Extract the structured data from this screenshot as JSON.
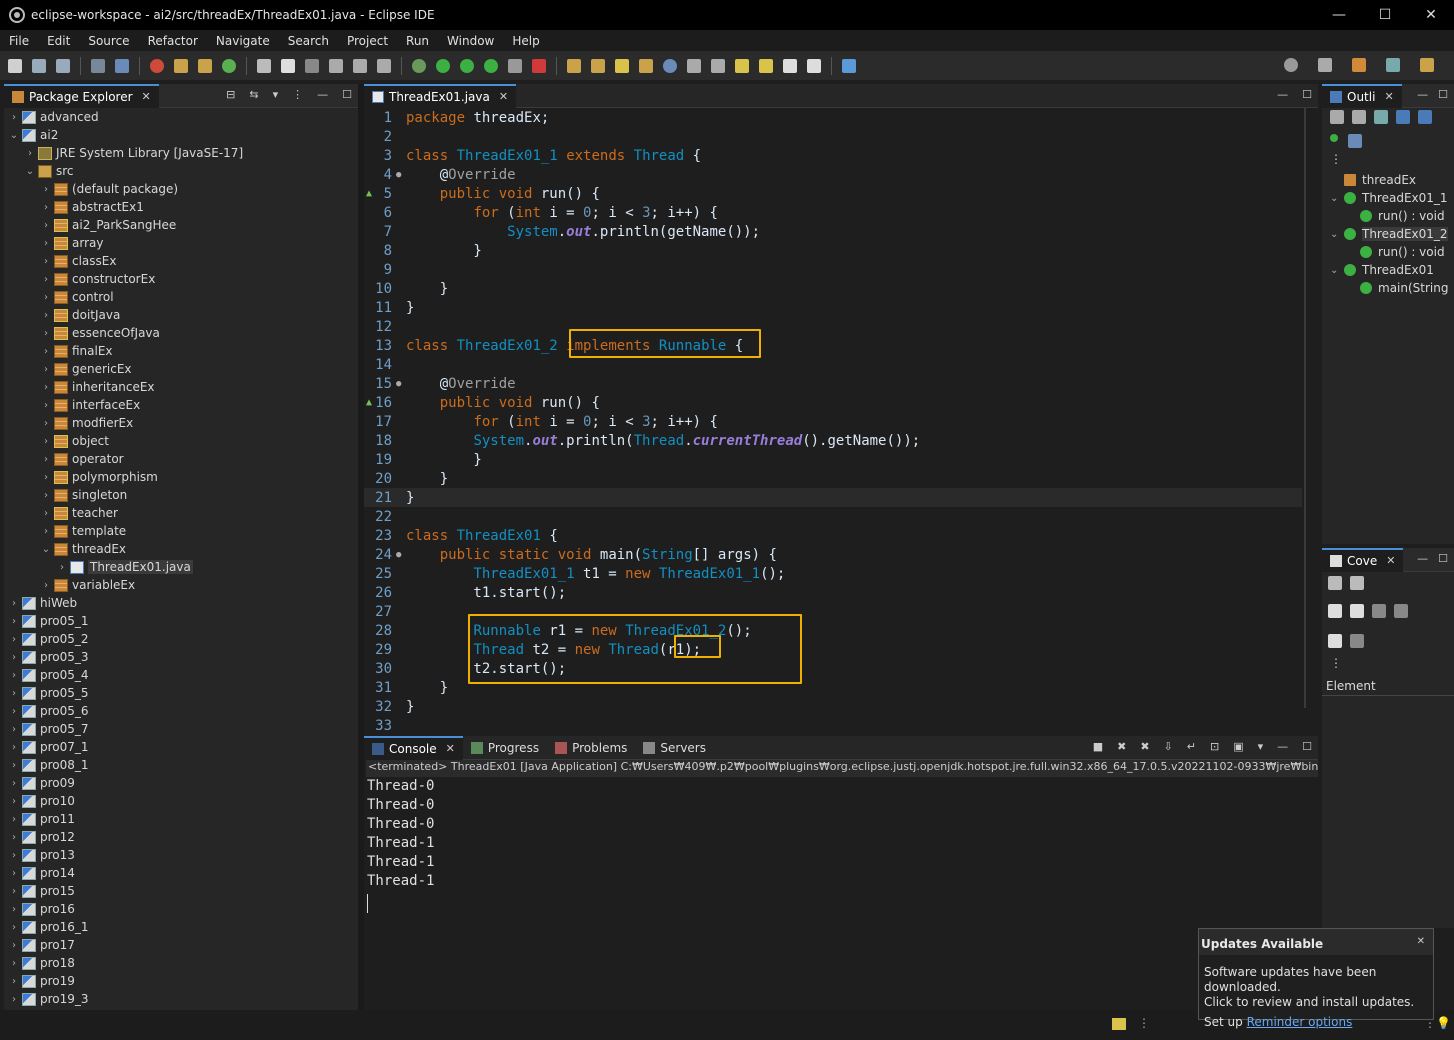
{
  "window": {
    "title": "eclipse-workspace - ai2/src/threadEx/ThreadEx01.java - Eclipse IDE",
    "minimize": "—",
    "maximize": "☐",
    "close": "✕"
  },
  "menu": [
    "File",
    "Edit",
    "Source",
    "Refactor",
    "Navigate",
    "Search",
    "Project",
    "Run",
    "Window",
    "Help"
  ],
  "package_explorer": {
    "tab_label": "Package Explorer",
    "items": [
      {
        "label": "advanced",
        "arrow": "›",
        "icon": "proj",
        "depth": 0
      },
      {
        "label": "ai2",
        "arrow": "⌄",
        "icon": "proj",
        "depth": 0
      },
      {
        "label": "JRE System Library [JavaSE-17]",
        "arrow": "›",
        "icon": "lib",
        "depth": 1
      },
      {
        "label": "src",
        "arrow": "⌄",
        "icon": "src",
        "depth": 1
      },
      {
        "label": "(default package)",
        "arrow": "›",
        "icon": "pkg",
        "depth": 2
      },
      {
        "label": "abstractEx1",
        "arrow": "›",
        "icon": "pkg",
        "depth": 2
      },
      {
        "label": "ai2_ParkSangHee",
        "arrow": "›",
        "icon": "pkgx",
        "depth": 2
      },
      {
        "label": "array",
        "arrow": "›",
        "icon": "pkgx",
        "depth": 2
      },
      {
        "label": "classEx",
        "arrow": "›",
        "icon": "pkg",
        "depth": 2
      },
      {
        "label": "constructorEx",
        "arrow": "›",
        "icon": "pkg",
        "depth": 2
      },
      {
        "label": "control",
        "arrow": "›",
        "icon": "pkg",
        "depth": 2
      },
      {
        "label": "doitJava",
        "arrow": "›",
        "icon": "pkgx",
        "depth": 2
      },
      {
        "label": "essenceOfJava",
        "arrow": "›",
        "icon": "pkgx",
        "depth": 2
      },
      {
        "label": "finalEx",
        "arrow": "›",
        "icon": "pkg",
        "depth": 2
      },
      {
        "label": "genericEx",
        "arrow": "›",
        "icon": "pkg",
        "depth": 2
      },
      {
        "label": "inheritanceEx",
        "arrow": "›",
        "icon": "pkg",
        "depth": 2
      },
      {
        "label": "interfaceEx",
        "arrow": "›",
        "icon": "pkg",
        "depth": 2
      },
      {
        "label": "modfierEx",
        "arrow": "›",
        "icon": "pkg",
        "depth": 2
      },
      {
        "label": "object",
        "arrow": "›",
        "icon": "pkgx",
        "depth": 2
      },
      {
        "label": "operator",
        "arrow": "›",
        "icon": "pkg",
        "depth": 2
      },
      {
        "label": "polymorphism",
        "arrow": "›",
        "icon": "pkgx",
        "depth": 2
      },
      {
        "label": "singleton",
        "arrow": "›",
        "icon": "pkg",
        "depth": 2
      },
      {
        "label": "teacher",
        "arrow": "›",
        "icon": "pkgx",
        "depth": 2
      },
      {
        "label": "template",
        "arrow": "›",
        "icon": "pkg",
        "depth": 2
      },
      {
        "label": "threadEx",
        "arrow": "⌄",
        "icon": "pkg",
        "depth": 2
      },
      {
        "label": "ThreadEx01.java",
        "arrow": "›",
        "icon": "java",
        "depth": 3,
        "selected": true
      },
      {
        "label": "variableEx",
        "arrow": "›",
        "icon": "pkg",
        "depth": 2
      },
      {
        "label": "hiWeb",
        "arrow": "›",
        "icon": "proj",
        "depth": 0
      },
      {
        "label": "pro05_1",
        "arrow": "›",
        "icon": "proj",
        "depth": 0
      },
      {
        "label": "pro05_2",
        "arrow": "›",
        "icon": "proj",
        "depth": 0
      },
      {
        "label": "pro05_3",
        "arrow": "›",
        "icon": "proj",
        "depth": 0
      },
      {
        "label": "pro05_4",
        "arrow": "›",
        "icon": "proj",
        "depth": 0
      },
      {
        "label": "pro05_5",
        "arrow": "›",
        "icon": "proj",
        "depth": 0
      },
      {
        "label": "pro05_6",
        "arrow": "›",
        "icon": "proj",
        "depth": 0
      },
      {
        "label": "pro05_7",
        "arrow": "›",
        "icon": "proj",
        "depth": 0
      },
      {
        "label": "pro07_1",
        "arrow": "›",
        "icon": "proj",
        "depth": 0
      },
      {
        "label": "pro08_1",
        "arrow": "›",
        "icon": "proj",
        "depth": 0
      },
      {
        "label": "pro09",
        "arrow": "›",
        "icon": "proj",
        "depth": 0
      },
      {
        "label": "pro10",
        "arrow": "›",
        "icon": "proj",
        "depth": 0
      },
      {
        "label": "pro11",
        "arrow": "›",
        "icon": "proj",
        "depth": 0
      },
      {
        "label": "pro12",
        "arrow": "›",
        "icon": "proj",
        "depth": 0
      },
      {
        "label": "pro13",
        "arrow": "›",
        "icon": "proj",
        "depth": 0
      },
      {
        "label": "pro14",
        "arrow": "›",
        "icon": "proj",
        "depth": 0
      },
      {
        "label": "pro15",
        "arrow": "›",
        "icon": "proj",
        "depth": 0
      },
      {
        "label": "pro16",
        "arrow": "›",
        "icon": "proj",
        "depth": 0
      },
      {
        "label": "pro16_1",
        "arrow": "›",
        "icon": "proj",
        "depth": 0
      },
      {
        "label": "pro17",
        "arrow": "›",
        "icon": "proj",
        "depth": 0
      },
      {
        "label": "pro18",
        "arrow": "›",
        "icon": "proj",
        "depth": 0
      },
      {
        "label": "pro19",
        "arrow": "›",
        "icon": "proj",
        "depth": 0
      },
      {
        "label": "pro19_3",
        "arrow": "›",
        "icon": "proj",
        "depth": 0
      }
    ]
  },
  "editor": {
    "tab_label": "ThreadEx01.java",
    "lines": [
      {
        "n": "1",
        "t": "package threadEx;"
      },
      {
        "n": "2",
        "t": ""
      },
      {
        "n": "3",
        "t": "class ThreadEx01_1 extends Thread {"
      },
      {
        "n": "4",
        "t": "    @Override"
      },
      {
        "n": "5",
        "t": "    public void run() {"
      },
      {
        "n": "6",
        "t": "        for (int i = 0; i < 3; i++) {"
      },
      {
        "n": "7",
        "t": "            System.out.println(getName());"
      },
      {
        "n": "8",
        "t": "        }"
      },
      {
        "n": "9",
        "t": ""
      },
      {
        "n": "10",
        "t": "    }"
      },
      {
        "n": "11",
        "t": "}"
      },
      {
        "n": "12",
        "t": ""
      },
      {
        "n": "13",
        "t": "class ThreadEx01_2 implements Runnable {"
      },
      {
        "n": "14",
        "t": ""
      },
      {
        "n": "15",
        "t": "    @Override"
      },
      {
        "n": "16",
        "t": "    public void run() {"
      },
      {
        "n": "17",
        "t": "        for (int i = 0; i < 3; i++) {"
      },
      {
        "n": "18",
        "t": "        System.out.println(Thread.currentThread().getName());"
      },
      {
        "n": "19",
        "t": "        }"
      },
      {
        "n": "20",
        "t": "    }"
      },
      {
        "n": "21",
        "t": "}"
      },
      {
        "n": "22",
        "t": ""
      },
      {
        "n": "23",
        "t": "class ThreadEx01 {"
      },
      {
        "n": "24",
        "t": "    public static void main(String[] args) {"
      },
      {
        "n": "25",
        "t": "        ThreadEx01_1 t1 = new ThreadEx01_1();"
      },
      {
        "n": "26",
        "t": "        t1.start();"
      },
      {
        "n": "27",
        "t": ""
      },
      {
        "n": "28",
        "t": "        Runnable r1 = new ThreadEx01_2();"
      },
      {
        "n": "29",
        "t": "        Thread t2 = new Thread(r1);"
      },
      {
        "n": "30",
        "t": "        t2.start();"
      },
      {
        "n": "31",
        "t": "    }"
      },
      {
        "n": "32",
        "t": "}"
      },
      {
        "n": "33",
        "t": ""
      }
    ]
  },
  "console": {
    "tabs": [
      "Console",
      "Progress",
      "Problems",
      "Servers"
    ],
    "path": "<terminated> ThreadEx01 [Java Application] C:₩Users₩409₩.p2₩pool₩plugins₩org.eclipse.justj.openjdk.hotspot.jre.full.win32.x86_64_17.0.5.v20221102-0933₩jre₩bin₩javaw.e",
    "output": [
      "Thread-0",
      "Thread-0",
      "Thread-0",
      "Thread-1",
      "Thread-1",
      "Thread-1"
    ]
  },
  "outline": {
    "tab_label": "Outli",
    "items": [
      "threadEx",
      "ThreadEx01_1",
      "run() : void",
      "ThreadEx01_2",
      "run() : void",
      "ThreadEx01",
      "main(String"
    ]
  },
  "coverage": {
    "tab_label": "Cove",
    "column": "Element"
  },
  "popup": {
    "title": "Updates Available",
    "close": "✕",
    "line1": "Software updates have been downloaded.",
    "line2": "Click to review and install updates.",
    "setup": "Set up",
    "link": "Reminder options"
  },
  "colors": {
    "highlight_box": "#f0b000",
    "keyword": "#cc6c1d",
    "type": "#1290c3"
  }
}
